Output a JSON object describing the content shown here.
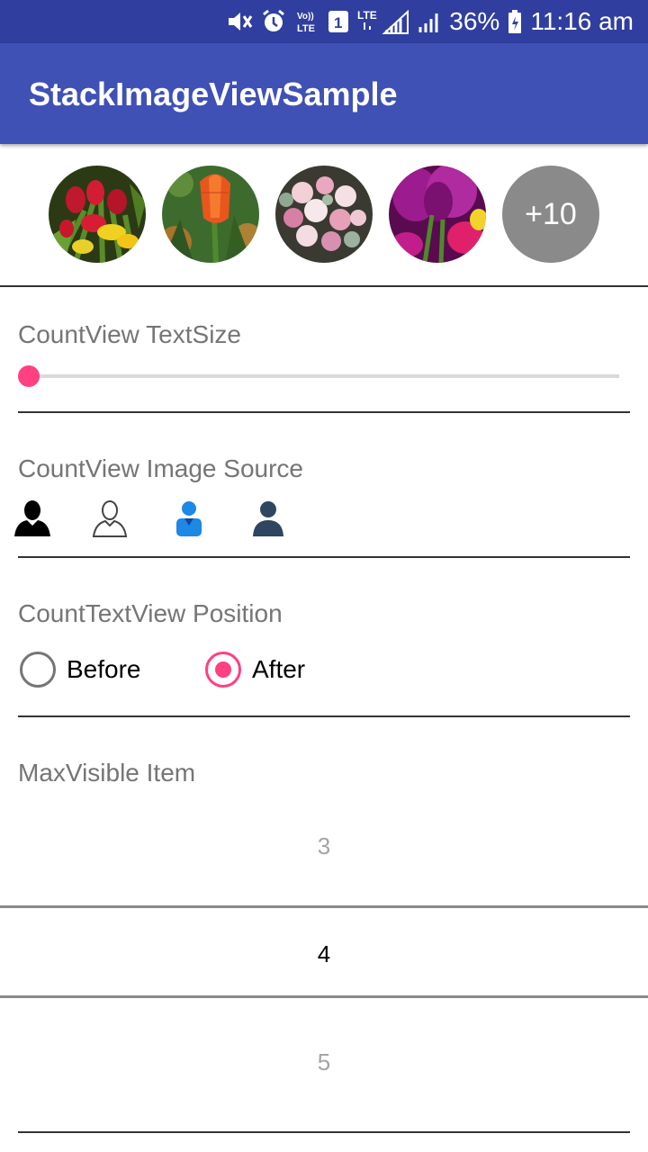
{
  "status_bar": {
    "battery": "36%",
    "time": "11:16 am",
    "icons": [
      "mute-icon",
      "alarm-icon",
      "volte-icon",
      "sim-1-icon",
      "lte-signal-icon",
      "signal-icon",
      "battery-icon"
    ]
  },
  "app_bar": {
    "title": "StackImageViewSample"
  },
  "stack": {
    "images": [
      "tulips-red-yellow",
      "tulip-orange",
      "rose-bouquet",
      "tulip-purple"
    ],
    "count_label": "+10"
  },
  "text_size": {
    "title": "CountView TextSize",
    "value": 0
  },
  "image_source": {
    "title": "CountView Image Source",
    "icons": [
      "person-black-icon",
      "person-outline-icon",
      "person-blue-icon",
      "person-navy-icon"
    ]
  },
  "position": {
    "title": "CountTextView Position",
    "options": [
      {
        "label": "Before",
        "selected": false
      },
      {
        "label": "After",
        "selected": true
      }
    ]
  },
  "max_visible": {
    "title": "MaxVisible Item",
    "prev": "3",
    "current": "4",
    "next": "5"
  },
  "colors": {
    "primary": "#3f51b5",
    "primary_dark": "#303f9f",
    "accent": "#ff4081"
  }
}
